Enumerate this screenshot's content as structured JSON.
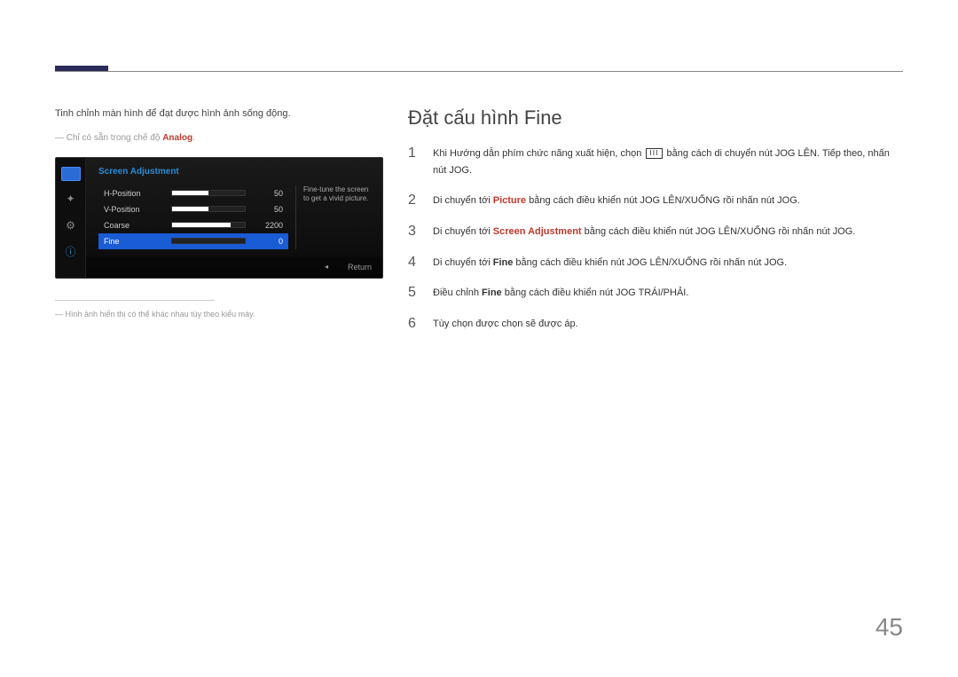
{
  "intro": "Tinh chỉnh màn hình để đạt được hình ảnh sống động.",
  "note_prefix": "― Chỉ có sẵn trong chế độ ",
  "note_highlight": "Analog",
  "note_suffix": ".",
  "osd": {
    "title": "Screen Adjustment",
    "help": "Fine-tune the screen to get a vivid picture.",
    "rows": [
      {
        "label": "H-Position",
        "value": "50",
        "pct": 50,
        "selected": false
      },
      {
        "label": "V-Position",
        "value": "50",
        "pct": 50,
        "selected": false
      },
      {
        "label": "Coarse",
        "value": "2200",
        "pct": 80,
        "selected": false
      },
      {
        "label": "Fine",
        "value": "0",
        "pct": 0,
        "selected": true
      }
    ],
    "footer_nav": "◂",
    "footer_return": "Return"
  },
  "footnote": "― Hình ảnh hiển thị có thể khác nhau tùy theo kiểu máy.",
  "section_title": "Đặt cấu hình Fine",
  "steps": {
    "s1a": "Khi Hướng dẫn phím chức năng xuất hiện, chọn ",
    "s1b": " bằng cách di chuyển nút JOG LÊN. Tiếp theo, nhấn nút JOG.",
    "s2a": "Di chuyển tới ",
    "s2h": "Picture",
    "s2b": " bằng cách điều khiển nút JOG LÊN/XUỐNG rồi nhấn nút JOG.",
    "s3a": "Di chuyển tới ",
    "s3h": "Screen Adjustment",
    "s3b": " bằng cách điều khiển nút JOG LÊN/XUỐNG rồi nhấn nút JOG.",
    "s4a": "Di chuyển tới ",
    "s4h": "Fine",
    "s4b": " bằng cách điều khiển nút JOG LÊN/XUỐNG rồi nhấn nút JOG.",
    "s5a": "Điều chỉnh ",
    "s5h": "Fine",
    "s5b": " bằng cách điều khiển nút JOG TRÁI/PHẢI.",
    "s6": "Tùy chọn được chọn sẽ được áp."
  },
  "menu_glyph": "ⅠⅠⅠ",
  "page_number": "45"
}
